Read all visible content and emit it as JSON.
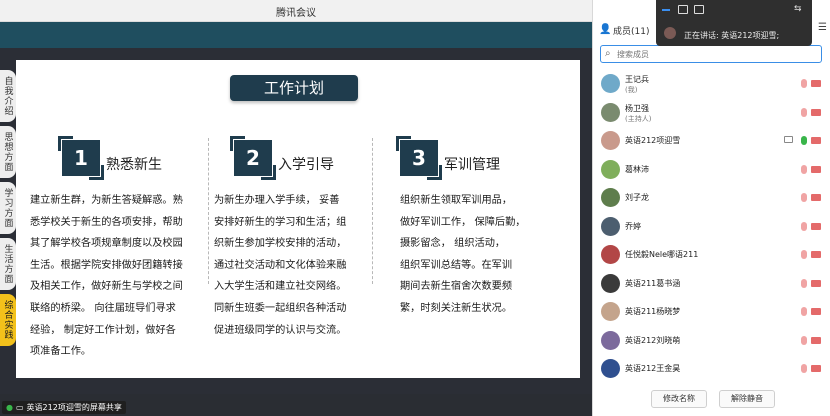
{
  "window": {
    "title": "腾讯会议"
  },
  "left_tabs": [
    "自我介绍",
    "思想方面",
    "学习方面",
    "生活方面",
    "综合实践"
  ],
  "slide": {
    "title": "工作计划",
    "columns": [
      {
        "num": "1",
        "heading": "熟悉新生",
        "body": "建立新生群，为新生答疑解惑。熟\n悉学校关于新生的各项安排，帮助\n其了解学校各项规章制度以及校园\n生活。根据学院安排做好团籍转接\n及相关工作，做好新生与学校之间\n联络的桥梁。  向往届班导们寻求\n经验，  制定好工作计划，做好各\n项准备工作。"
      },
      {
        "num": "2",
        "heading": "入学引导",
        "body": "为新生办理入学手续，  妥善\n安排好新生的学习和生活；组\n织新生参加学校安排的活动，\n通过社交活动和文化体验来融\n入大学生活和建立社交网络。\n同新生班委一起组织各种活动\n促进班级同学的认识与交流。"
      },
      {
        "num": "3",
        "heading": "军训管理",
        "body": "组织新生领取军训用品，\n做好军训工作，  保障后勤，\n摄影留念，  组织活动，\n组织军训总结等。在军训\n期间去新生宿舍次数要频\n繁，时刻关注新生状况。"
      }
    ]
  },
  "share_tag": "英语212项迎雪的屏幕共享",
  "panel": {
    "members_label": "成员(11)",
    "search_placeholder": "搜索成员",
    "members": [
      {
        "name": "王记兵",
        "role": "(我)",
        "avatar": "#6fa9c9",
        "mic": "off",
        "cam": "on"
      },
      {
        "name": "杨卫强",
        "role": "(主持人)",
        "avatar": "#7a8b6f",
        "mic": "off",
        "cam": "on"
      },
      {
        "name": "英语212项迎雪",
        "role": "",
        "avatar": "#c99a8c",
        "mic": "on",
        "cam": "on",
        "screen": true
      },
      {
        "name": "葛林沛",
        "role": "",
        "avatar": "#7fae5b",
        "mic": "off",
        "cam": "on"
      },
      {
        "name": "刘子龙",
        "role": "",
        "avatar": "#5e7d4c",
        "mic": "off",
        "cam": "on"
      },
      {
        "name": "乔婷",
        "role": "",
        "avatar": "#4c5e6f",
        "mic": "off",
        "cam": "on"
      },
      {
        "name": "任悦毅Nele哪语211",
        "role": "",
        "avatar": "#b24646",
        "mic": "off",
        "cam": "on"
      },
      {
        "name": "英语211葛书涵",
        "role": "",
        "avatar": "#3a3a3a",
        "mic": "off",
        "cam": "on"
      },
      {
        "name": "英语211杨晓梦",
        "role": "",
        "avatar": "#c4a48c",
        "mic": "off",
        "cam": "on"
      },
      {
        "name": "英语212刘晓萌",
        "role": "",
        "avatar": "#7c6a9c",
        "mic": "off",
        "cam": "on"
      },
      {
        "name": "英语212王金昊",
        "role": "",
        "avatar": "#2f4f8f",
        "mic": "off",
        "cam": "on"
      }
    ],
    "rename_button": "修改名称",
    "unmute_button": "解除静音"
  },
  "speaking": {
    "label": "正在讲话:",
    "speaker": "英语212项迎雪;"
  }
}
